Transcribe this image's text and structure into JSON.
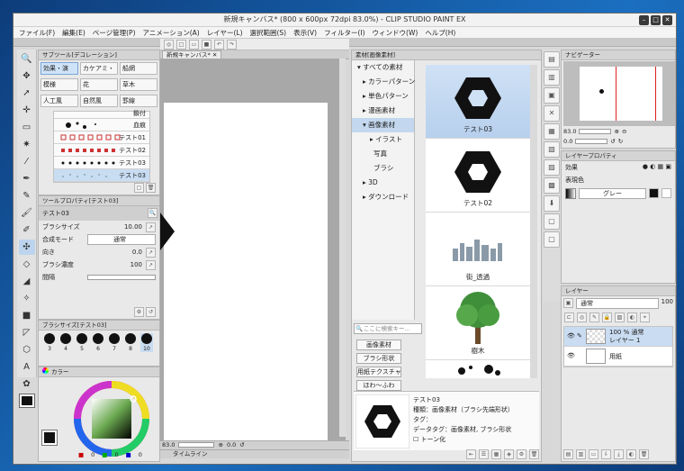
{
  "window": {
    "title": "新規キャンバス* (800 x 600px 72dpi 83.0%) - CLIP STUDIO PAINT EX"
  },
  "menu": [
    "ファイル(F)",
    "編集(E)",
    "ページ管理(P)",
    "アニメーション(A)",
    "レイヤー(L)",
    "選択範囲(S)",
    "表示(V)",
    "フィルター(I)",
    "ウィンドウ(W)",
    "ヘルプ(H)"
  ],
  "subtool": {
    "header": "サブツール[デコレーション]",
    "buttons": [
      [
        "効果・演",
        "カケアミ・",
        "船網"
      ],
      [
        "模様",
        "花",
        "草木"
      ],
      [
        "人工風",
        "自然風",
        "罫線"
      ]
    ],
    "brushes": [
      "血痕",
      "テスト01",
      "テスト02",
      "テスト03",
      "テスト03"
    ],
    "top_label": "鎖付"
  },
  "toolprop": {
    "header": "ツールプロパティ[テスト03]",
    "name": "テスト03",
    "rows": [
      {
        "label": "ブラシサイズ",
        "value": "10.00"
      },
      {
        "label": "合成モード",
        "value": "通常"
      },
      {
        "label": "向き",
        "value": "0.0"
      },
      {
        "label": "ブラシ濃度",
        "value": "100"
      },
      {
        "label": "間隔",
        "value": ""
      }
    ]
  },
  "brushsize": {
    "header": "ブラシサイズ[テスト03]",
    "sizes": [
      "3",
      "4",
      "5",
      "6",
      "7",
      "8",
      "10"
    ]
  },
  "color": {
    "header": "カラー",
    "values": [
      "0",
      "0",
      "0"
    ]
  },
  "canvas": {
    "tab": "新規キャンバス*",
    "zoom": "83.0",
    "angle": "0.0",
    "timeline": "タイムライン"
  },
  "material": {
    "header": "素材[画像素材]",
    "tree": [
      "すべての素材",
      "カラーパターン",
      "単色パターン",
      "漫画素材",
      "画像素材",
      "イラスト",
      "写真",
      "ブラシ",
      "3D",
      "ダウンロード"
    ],
    "items": [
      "テスト03",
      "テスト02",
      "街_透過",
      "樹木"
    ],
    "search_placeholder": "ここに検索キー...",
    "tags": [
      "画像素材",
      "ブラシ形状",
      "用紙テクスチャ",
      "ほわ～ふわ"
    ],
    "detail": {
      "name": "テスト03",
      "type": "種類：画像素材（ブラシ先端形状）",
      "tag": "タグ：",
      "datatag": "データタグ：画像素材, ブラシ形状",
      "tone": "トーン化"
    }
  },
  "navigator": {
    "header": "ナビゲーター",
    "zoom": "83.0",
    "angle": "0.0"
  },
  "layerprop": {
    "header": "レイヤープロパティ",
    "effect": "効果",
    "color_label": "表現色",
    "color_value": "グレー"
  },
  "layers": {
    "header": "レイヤー",
    "blend": "通常",
    "opacity": "100",
    "items": [
      {
        "pct": "100 %",
        "mode": "通常",
        "name": "レイヤー 1"
      },
      {
        "name": "用紙"
      }
    ]
  }
}
